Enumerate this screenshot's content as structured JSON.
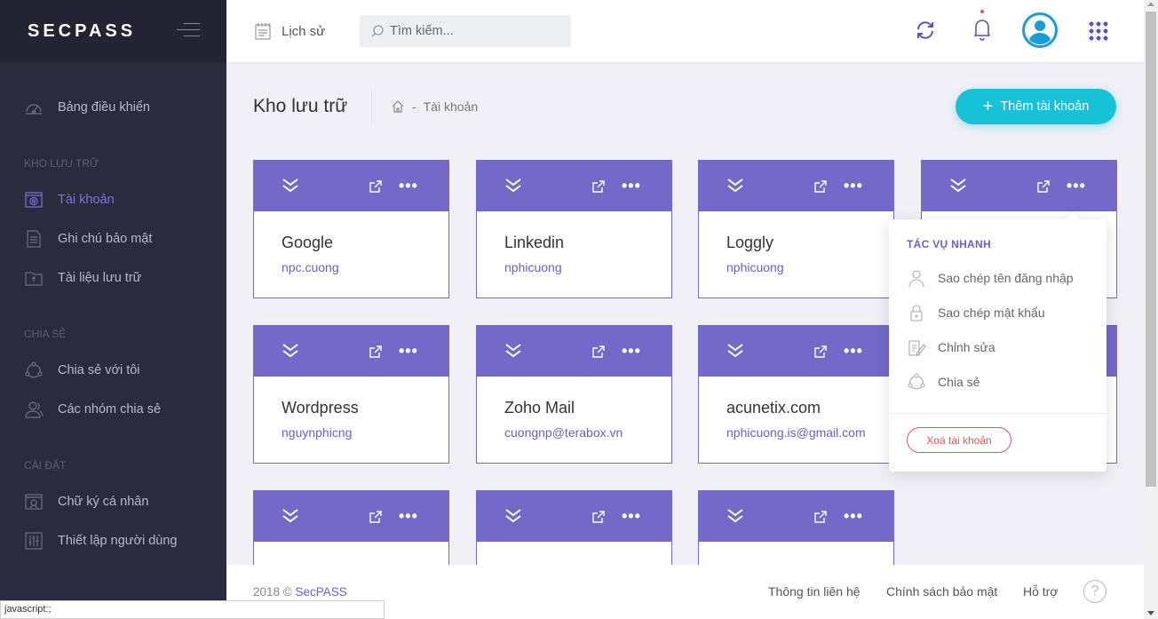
{
  "brand": "SECPASS",
  "sidebar": {
    "dashboard": "Bảng điều khiển",
    "section_storage": "KHO LƯU TRỮ",
    "accounts": "Tài khoản",
    "secure_notes": "Ghi chú bảo mật",
    "documents": "Tài liệu lưu trữ",
    "section_share": "CHIA SẺ",
    "shared_with_me": "Chia sẻ với tôi",
    "share_groups": "Các nhóm chia sẻ",
    "section_settings": "CÀI ĐẶT",
    "signature": "Chữ ký cá nhân",
    "user_settings": "Thiết lập người dùng"
  },
  "topbar": {
    "history": "Lịch sử",
    "search_placeholder": "Tìm kiếm..."
  },
  "page": {
    "title": "Kho lưu trữ",
    "breadcrumb_sep": "-",
    "breadcrumb_current": "Tài khoản",
    "add_button": "Thêm tài khoản"
  },
  "cards": [
    {
      "title": "Google",
      "user": "npc.cuong"
    },
    {
      "title": "Linkedin",
      "user": "nphicuong"
    },
    {
      "title": "Loggly",
      "user": "nphicuong"
    },
    {
      "title": "",
      "user": ""
    },
    {
      "title": "Wordpress",
      "user": "nguynphicng"
    },
    {
      "title": "Zoho Mail",
      "user": "cuongnp@terabox.vn"
    },
    {
      "title": "acunetix.com",
      "user": "nphicuong.is@gmail.com"
    },
    {
      "title": "",
      "user": ""
    },
    {
      "title": "",
      "user": ""
    },
    {
      "title": "",
      "user": ""
    },
    {
      "title": "",
      "user": ""
    }
  ],
  "dropdown": {
    "title": "TÁC VỤ NHANH",
    "copy_username": "Sao chép tên đăng nhập",
    "copy_password": "Sao chép mật khẩu",
    "edit": "Chỉnh sửa",
    "share": "Chia sẻ",
    "delete": "Xoá tài khoản"
  },
  "footer": {
    "year": "2018 ©",
    "brand": "SecPASS",
    "contact": "Thông tin liên hệ",
    "privacy": "Chính sách bảo mật",
    "support": "Hỗ trợ",
    "help": "?"
  },
  "status_bar": "javascript:;",
  "colors": {
    "accent": "#7468c8",
    "primary_button": "#17c1d6",
    "danger": "#e05562",
    "sidebar_bg": "#2b2b3d"
  }
}
